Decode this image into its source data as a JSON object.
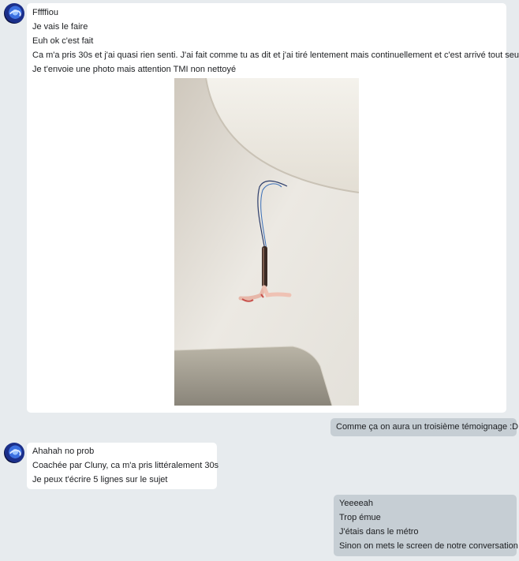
{
  "thread": {
    "group1": {
      "lines": [
        "Fffffiou",
        "Je vais le faire",
        "Euh ok c'est fait",
        "Ca m'a pris 30s et j'ai quasi rien senti. J'ai fait comme tu as dit et j'ai tiré lentement mais continuellement et c'est arrivé tout seul",
        "Je t'envoie une photo mais attention TMI non nettoyé"
      ]
    },
    "reply1": {
      "text": "Comme ça on aura un troisième témoignage :D"
    },
    "group2": {
      "lines": [
        "Ahahah no prob",
        "Coachée par Cluny, ca m'a pris littéralement 30s",
        "Je peux t'écrire 5 lignes sur le sujet"
      ]
    },
    "reply2": {
      "lines": [
        "Yeeeeah",
        "Trop émue",
        "J'étais dans le métro",
        "Sinon on mets le screen de notre conversation"
      ]
    }
  },
  "colors": {
    "background": "#e7ebee",
    "incoming_bubble": "#ffffff",
    "outgoing_bubble": "#c6ced4",
    "text": "#1c1e21"
  }
}
